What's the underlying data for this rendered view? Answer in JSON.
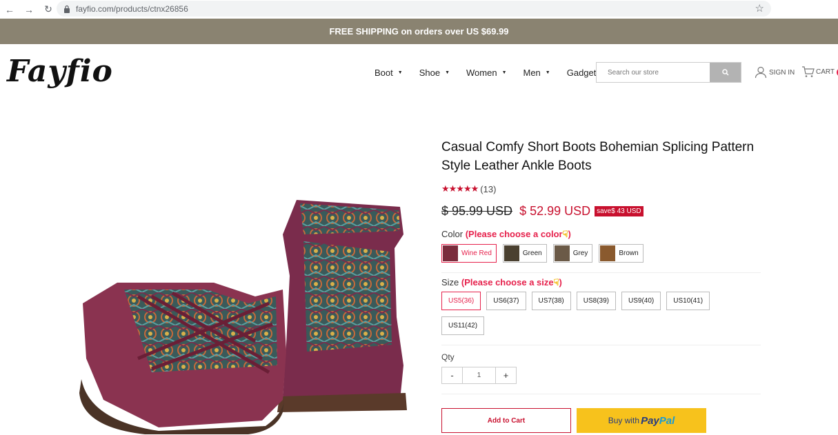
{
  "browser": {
    "url": "fayfio.com/products/ctnx26856"
  },
  "banner": {
    "text": "FREE SHIPPING on orders over US $69.99"
  },
  "header": {
    "logo_text": "Fayfio",
    "menu": [
      {
        "label": "Boot"
      },
      {
        "label": "Shoe"
      },
      {
        "label": "Women"
      },
      {
        "label": "Men"
      },
      {
        "label": "Gadget"
      }
    ],
    "search_placeholder": "Search our store",
    "sign_in": "SIGN IN",
    "cart": "CART"
  },
  "product": {
    "title": "Casual Comfy Short Boots Bohemian Splicing Pattern Style Leather Ankle Boots",
    "stars": "★★★★★",
    "review_count": "(13)",
    "old_price": "$ 95.99 USD",
    "new_price": "$ 52.99 USD",
    "save": "save$ 43 USD",
    "color_label": "Color",
    "color_prompt": "(Please choose a color",
    "color_prompt_end": ")",
    "colors": [
      {
        "label": "Wine Red",
        "selected": true,
        "thumb": "#7a2c3c"
      },
      {
        "label": "Green",
        "selected": false,
        "thumb": "#4a4030"
      },
      {
        "label": "Grey",
        "selected": false,
        "thumb": "#6b5a47"
      },
      {
        "label": "Brown",
        "selected": false,
        "thumb": "#8a5a2e"
      }
    ],
    "size_label": "Size",
    "size_prompt": "(Please choose a size",
    "size_prompt_end": ")",
    "sizes": [
      {
        "label": "US5(36)",
        "selected": true
      },
      {
        "label": "US6(37)",
        "selected": false
      },
      {
        "label": "US7(38)",
        "selected": false
      },
      {
        "label": "US8(39)",
        "selected": false
      },
      {
        "label": "US9(40)",
        "selected": false
      },
      {
        "label": "US10(41)",
        "selected": false
      },
      {
        "label": "US11(42)",
        "selected": false
      }
    ],
    "qty_label": "Qty",
    "qty_minus": "-",
    "qty_value": "1",
    "qty_plus": "+",
    "add_to_cart": "Add to Cart",
    "buy_with": "Buy with",
    "paypal_1": "Pay",
    "paypal_2": "Pal"
  },
  "colors": {
    "banner_bg": "#8a8371",
    "accent": "#e6204b",
    "price_red": "#c8102e",
    "paypal_yellow": "#f7c21c"
  }
}
